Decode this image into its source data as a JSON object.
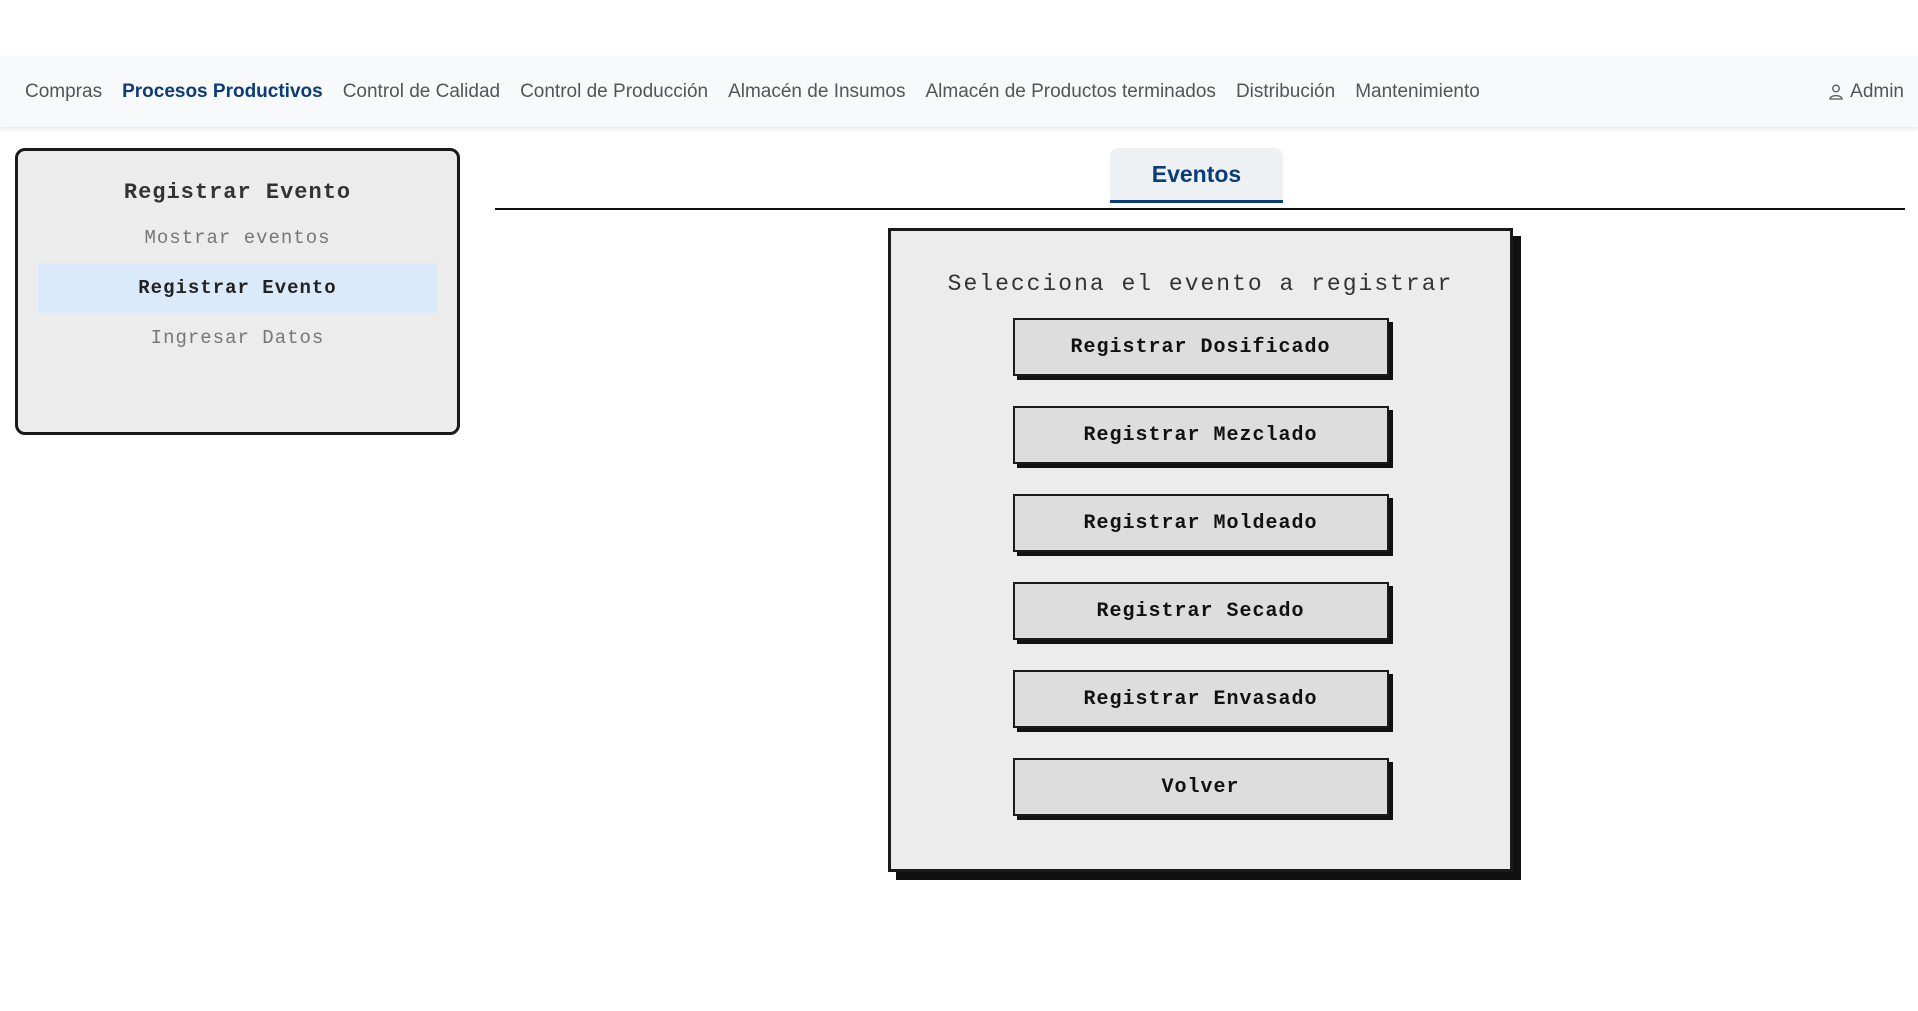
{
  "nav": {
    "items": [
      {
        "label": "Compras"
      },
      {
        "label": "Procesos Productivos"
      },
      {
        "label": "Control de Calidad"
      },
      {
        "label": "Control de Producción"
      },
      {
        "label": "Almacén de Insumos"
      },
      {
        "label": "Almacén de Productos terminados"
      },
      {
        "label": "Distribución"
      },
      {
        "label": "Mantenimiento"
      }
    ],
    "active_item": "Procesos Productivos",
    "user_label": "Admin",
    "user_icon": "user-icon"
  },
  "sidebar": {
    "title": "Registrar Evento",
    "items": [
      {
        "label": "Mostrar eventos"
      },
      {
        "label": "Registrar Evento"
      },
      {
        "label": "Ingresar Datos"
      }
    ],
    "active_item": "Registrar Evento"
  },
  "tabs": [
    {
      "label": "Eventos"
    }
  ],
  "panel": {
    "title": "Selecciona el evento a registrar",
    "buttons": [
      {
        "label": "Registrar Dosificado"
      },
      {
        "label": "Registrar Mezclado"
      },
      {
        "label": "Registrar Moldeado"
      },
      {
        "label": "Registrar Secado"
      },
      {
        "label": "Registrar Envasado"
      },
      {
        "label": "Volver"
      }
    ]
  },
  "colors": {
    "accent": "#0b3c7a",
    "sidebar_active_bg": "#dbeafb",
    "panel_bg": "#ececec",
    "button_bg": "#dddddd"
  }
}
